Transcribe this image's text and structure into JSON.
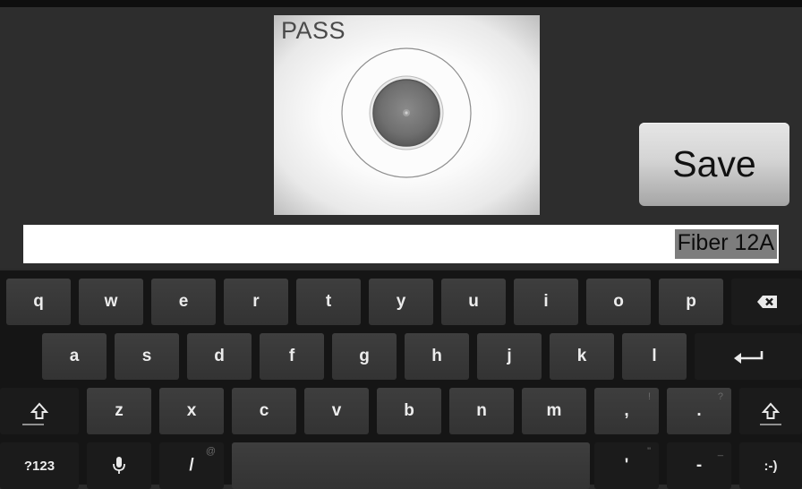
{
  "inspection": {
    "status": "PASS"
  },
  "toolbar": {
    "save_label": "Save"
  },
  "fiber_name_field": {
    "value": "Fiber 12A"
  },
  "keyboard": {
    "row1": [
      "q",
      "w",
      "e",
      "r",
      "t",
      "y",
      "u",
      "i",
      "o",
      "p"
    ],
    "row2": [
      "a",
      "s",
      "d",
      "f",
      "g",
      "h",
      "j",
      "k",
      "l"
    ],
    "row3": [
      "z",
      "x",
      "c",
      "v",
      "b",
      "n",
      "m",
      ",",
      "."
    ],
    "row3_hints": [
      "!",
      "?"
    ],
    "row4": {
      "mode_key": "?123",
      "slash_key": "/",
      "slash_hint": "@",
      "apostrophe_key": "'",
      "apostrophe_hint": "\"",
      "dash_key": "-",
      "dash_hint": "_",
      "smiley_key": ":-)"
    },
    "icons": {
      "backspace": "backspace-icon",
      "enter": "enter-icon",
      "shift": "shift-icon",
      "mic": "mic-icon"
    }
  }
}
